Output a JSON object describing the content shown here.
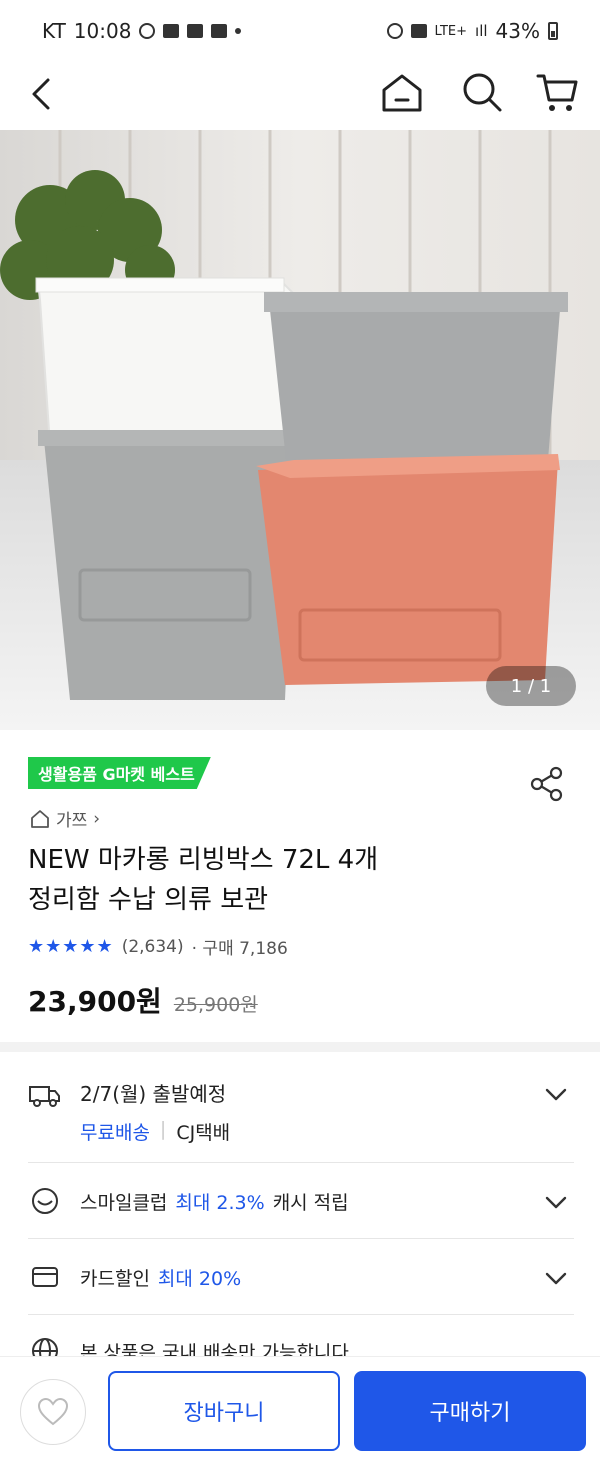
{
  "status_bar": {
    "carrier": "KT",
    "time": "10:08",
    "network": "LTE+",
    "battery": "43%"
  },
  "nav": {
    "icons": [
      "back-icon",
      "home-icon",
      "search-icon",
      "cart-icon"
    ]
  },
  "hero": {
    "pager": "1 / 1"
  },
  "product": {
    "badge": "생활용품 G마켓 베스트",
    "breadcrumb": "가쯔",
    "title_line1": "NEW 마카롱 리빙박스 72L 4개",
    "title_line2": "정리함 수납 의류 보관",
    "rating_stars": "★★★★★",
    "review_count": "(2,634)",
    "purchases": "· 구매 7,186",
    "price": "23,900원",
    "original_price": "25,900원"
  },
  "delivery": {
    "date": "2/7(월) 출발예정",
    "shipping": "무료배송",
    "courier": "CJ택배"
  },
  "smile_club": {
    "label": "스마일클럽",
    "highlight": "최대 2.3%",
    "suffix": "캐시 적립"
  },
  "card_discount": {
    "label": "카드할인",
    "highlight": "최대 20%"
  },
  "notice": "본 상품은 국내 배송만 가능합니다",
  "bottom_bar": {
    "cart_label": "장바구니",
    "buy_label": "구매하기"
  },
  "colors": {
    "accent": "#1f57e8",
    "badge": "#1fc84a"
  }
}
